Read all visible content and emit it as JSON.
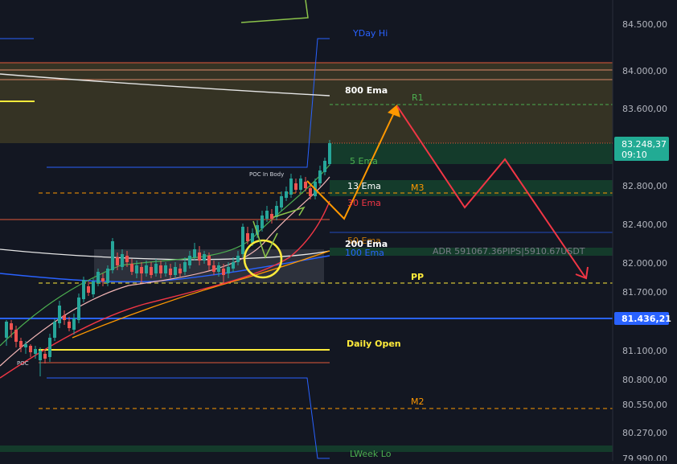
{
  "chart_data": {
    "type": "candlestick",
    "instrument_axis": {
      "ticks": [
        84500,
        84000,
        83600,
        82800,
        82400,
        82000,
        81700,
        81100,
        80800,
        80550,
        80270,
        79990
      ],
      "tick_labels": [
        "84.500,00",
        "84.000,00",
        "83.600,00",
        "82.800,00",
        "82.400,00",
        "82.000,00",
        "81.700,00",
        "81.100,00",
        "80.800,00",
        "80.550,00",
        "80.270,00",
        "79.990,00"
      ]
    },
    "current_price": {
      "label": "83.248,37",
      "countdown": "09:10",
      "color": "#22ab94"
    },
    "marked_price": {
      "label": "81.436,21",
      "color": "#2962ff"
    },
    "levels": [
      {
        "name": "YDay Hi",
        "color": "#2962ff"
      },
      {
        "name": "800 Ema",
        "color": "#ffffff"
      },
      {
        "name": "R1",
        "color": "#4caf50"
      },
      {
        "name": "5 Ema",
        "color": "#4caf50"
      },
      {
        "name": "13 Ema",
        "color": "#ffffff"
      },
      {
        "name": "M3",
        "color": "#ff9800"
      },
      {
        "name": "30 Ema",
        "color": "#f23645"
      },
      {
        "name": "200 Ema",
        "color": "#ffffff"
      },
      {
        "name": "100 Ema",
        "color": "#2962ff"
      },
      {
        "name": "PP",
        "color": "#ffeb3b"
      },
      {
        "name": "Daily Open",
        "color": "#ffeb3b"
      },
      {
        "name": "M2",
        "color": "#ff9800"
      },
      {
        "name": "LWeek Lo",
        "color": "#4caf50"
      }
    ],
    "annotations": {
      "poc_in_body": "POC In Body",
      "poc": "POC",
      "adr": "ADR 591067.36PIPS|5910.67USDT",
      "ema_overlap": "50 Ema"
    },
    "projection_path": {
      "up_leg_color": "#ff9800",
      "down_leg_color": "#f23645"
    },
    "grid": false
  }
}
